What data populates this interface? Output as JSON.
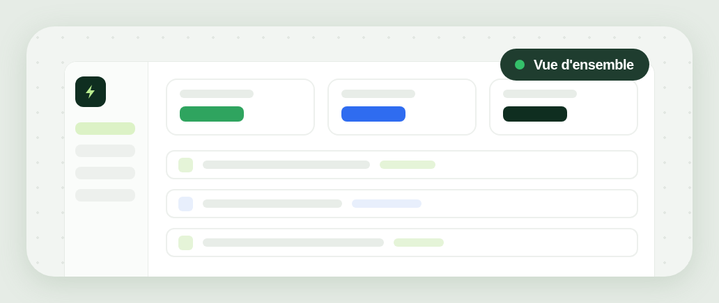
{
  "badge": {
    "label": "Vue d'ensemble",
    "active": true
  },
  "sidebar": {
    "items": [
      {
        "selected": true
      },
      {
        "selected": false
      },
      {
        "selected": false
      },
      {
        "selected": false
      }
    ]
  },
  "stat_cards": [
    {
      "color": "#2fa45f"
    },
    {
      "color": "#2f6cf0"
    },
    {
      "color": "#0f2e20"
    }
  ],
  "rows": [
    {
      "color": "#e5f4d8"
    },
    {
      "color": "#e8effc"
    },
    {
      "color": "#e5f4d8"
    }
  ]
}
